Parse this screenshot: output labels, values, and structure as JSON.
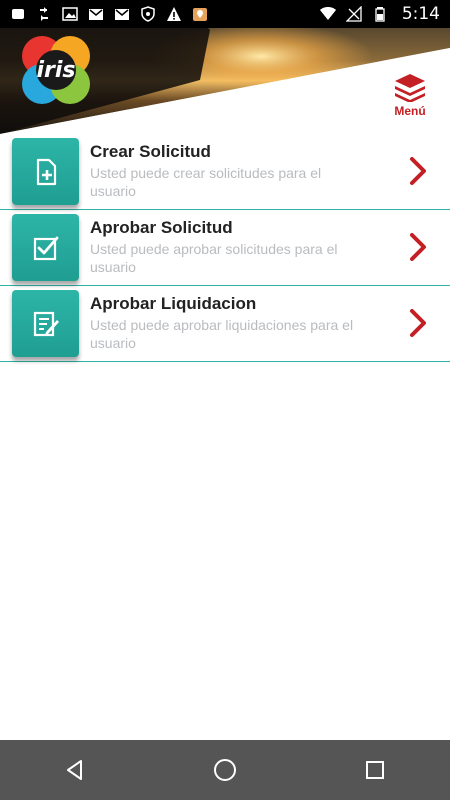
{
  "status_bar": {
    "time": "5:14",
    "icons_left": [
      "square-icon",
      "sync-icon",
      "image-icon",
      "gmail-icon",
      "gmail-icon",
      "shield-icon",
      "alert-icon",
      "location-icon"
    ],
    "icons_right": [
      "wifi-icon",
      "no-signal-icon",
      "battery-icon"
    ]
  },
  "header": {
    "logo_text": "iris",
    "menu_label": "Menú"
  },
  "items": [
    {
      "title": "Crear Solicitud",
      "description": "Usted puede crear solicitudes para el usuario",
      "icon": "file-add-icon"
    },
    {
      "title": "Aprobar Solicitud",
      "description": "Usted puede aprobar solicitudes para el usuario",
      "icon": "check-box-icon"
    },
    {
      "title": "Aprobar Liquidacion",
      "description": "Usted puede aprobar liquidaciones para el usuario",
      "icon": "document-edit-icon"
    }
  ],
  "colors": {
    "accent": "#2fb3a4",
    "brand_red": "#c41f24",
    "nav_bar": "#555555"
  }
}
